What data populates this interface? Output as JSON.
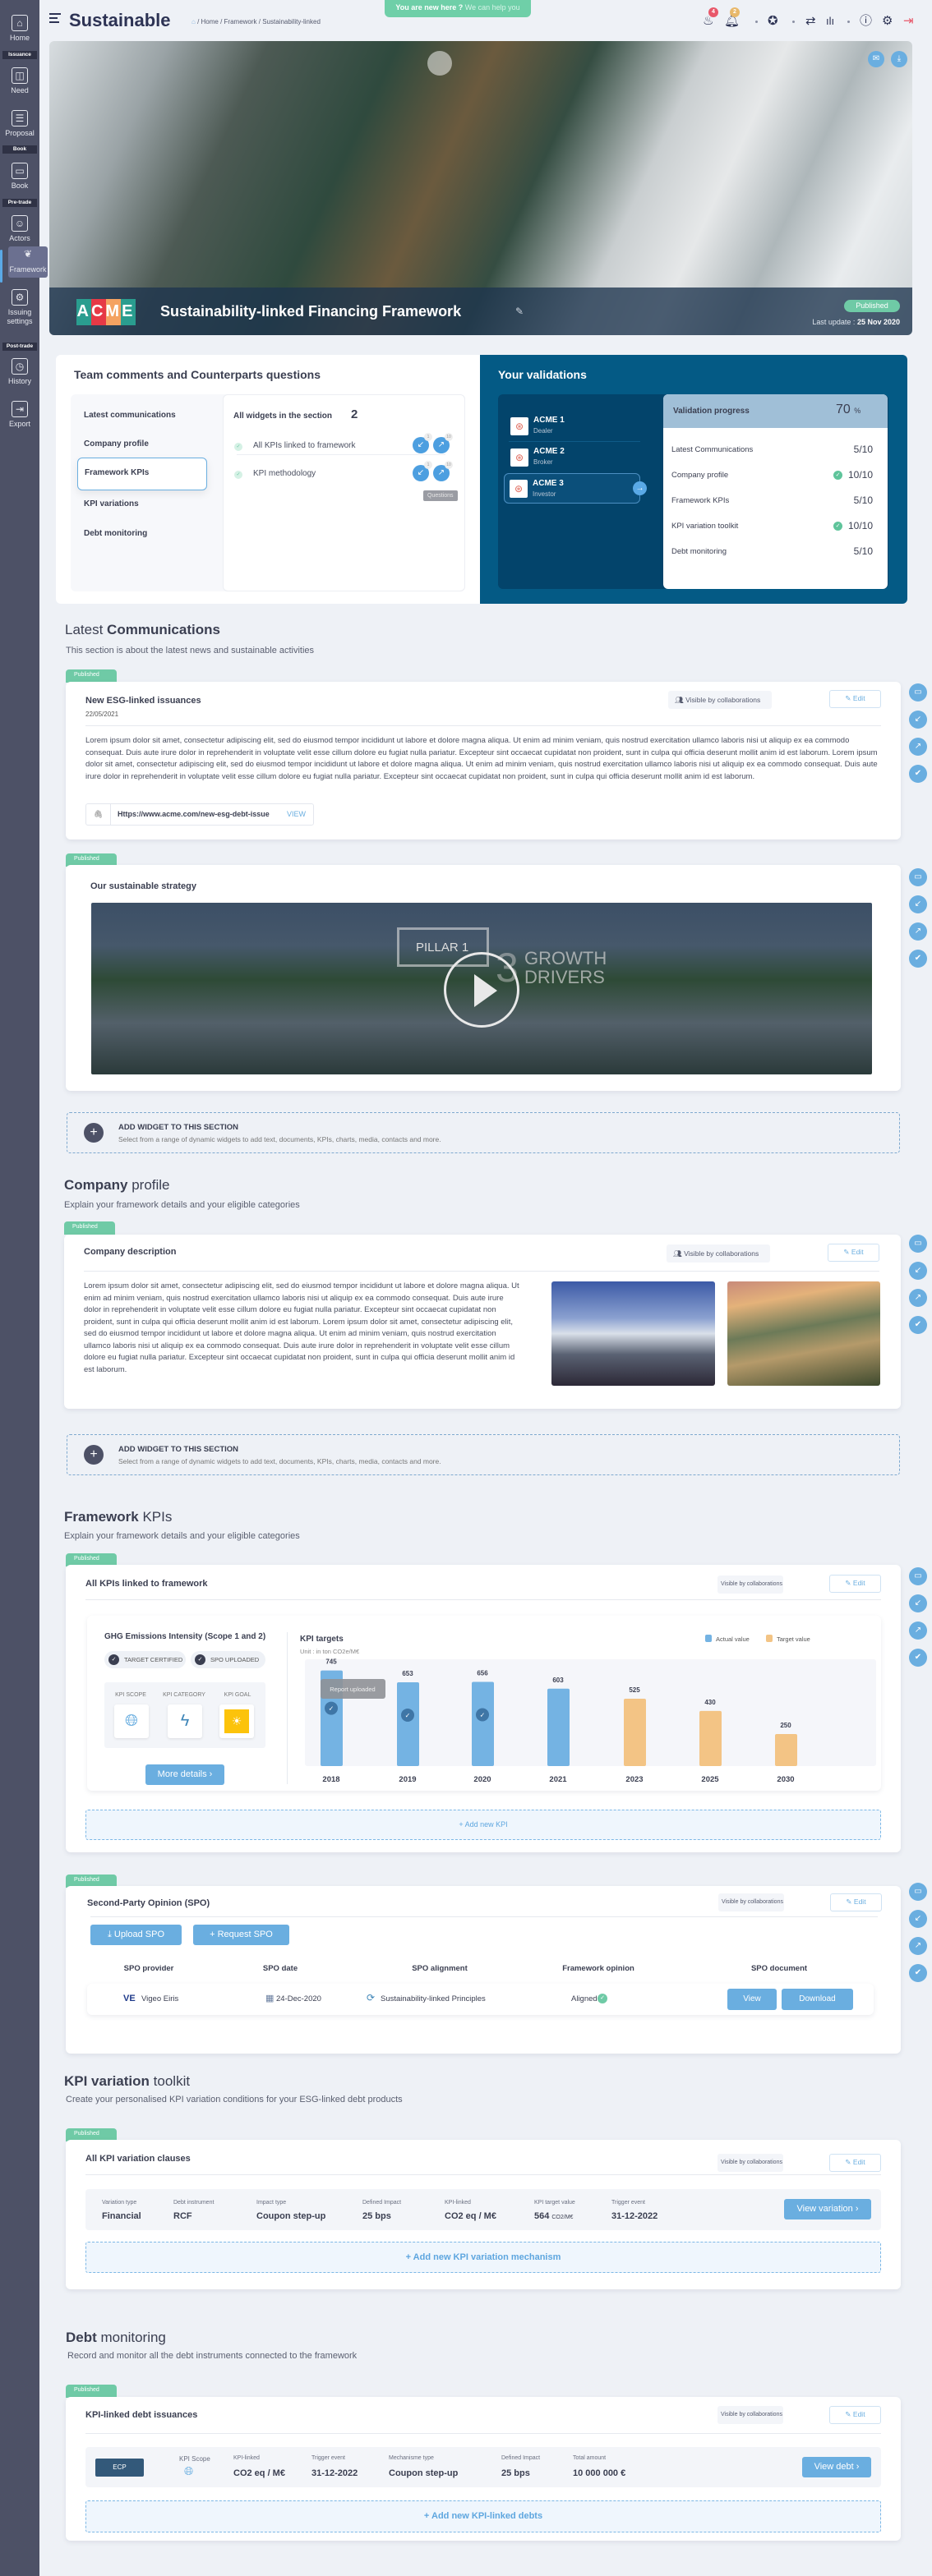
{
  "app": {
    "title": "Sustainable",
    "breadcrumb": "/ Home / Framework / Sustainability-linked",
    "help_strong": "You are new here ?",
    "help_link": "We can help you"
  },
  "header_icons": {
    "fire_badge": "4",
    "bell_badge": "2",
    "icons": [
      "fire-icon",
      "bell-icon",
      "award-icon",
      "transfer-icon",
      "bar-chart-icon",
      "help-icon",
      "gear-icon",
      "logout-icon"
    ]
  },
  "sidebar": {
    "items": [
      {
        "label": "Home",
        "icon": "home-icon"
      },
      {
        "tag": "Issuance"
      },
      {
        "label": "Need",
        "icon": "need-icon"
      },
      {
        "label": "Proposal",
        "icon": "proposal-icon"
      },
      {
        "tag": "Book"
      },
      {
        "label": "Book",
        "icon": "book-icon"
      },
      {
        "tag": "Pre-trade"
      },
      {
        "label": "Actors",
        "icon": "actors-icon"
      },
      {
        "label": "Framework",
        "icon": "framework-icon",
        "active": true
      },
      {
        "label": "Issuing settings",
        "icon": "settings-icon"
      },
      {
        "tag": "Post-trade"
      },
      {
        "label": "History",
        "icon": "history-icon"
      },
      {
        "label": "Export",
        "icon": "export-icon"
      }
    ]
  },
  "hero": {
    "logo": "ACME",
    "title": "Sustainability-linked Financing Framework",
    "status": "Published",
    "last_update_label": "Last update :",
    "last_update": "25 Nov 2020"
  },
  "comments": {
    "title": "Team comments and Counterparts questions",
    "nav": [
      "Latest communications",
      "Company profile",
      "Framework KPIs",
      "KPI variations",
      "Debt monitoring"
    ],
    "active_index": 2,
    "widgets_label": "All widgets in the section",
    "widgets_count": "2",
    "widgets": [
      {
        "name": "All KPIs linked to framework",
        "comments": "1",
        "questions": "10"
      },
      {
        "name": "KPI methodology",
        "comments": "1",
        "questions": "10"
      }
    ],
    "tooltip": "Questions"
  },
  "validations": {
    "title": "Your validations",
    "counterparts": [
      {
        "name": "ACME 1",
        "role": "Dealer"
      },
      {
        "name": "ACME 2",
        "role": "Broker"
      },
      {
        "name": "ACME 3",
        "role": "Investor",
        "active": true
      }
    ],
    "progress_label": "Validation progress",
    "progress_value": "70",
    "progress_unit": "%",
    "rows": [
      {
        "label": "Latest Communications",
        "value": "5/10",
        "done": false
      },
      {
        "label": "Company profile",
        "value": "10/10",
        "done": true
      },
      {
        "label": "Framework KPIs",
        "value": "5/10",
        "done": false
      },
      {
        "label": "KPI variation toolkit",
        "value": "10/10",
        "done": true
      },
      {
        "label": "Debt monitoring",
        "value": "5/10",
        "done": false
      }
    ]
  },
  "common": {
    "published": "Published",
    "visible": "Visible by collaborations",
    "edit": "Edit",
    "add_widget_title": "ADD WIDGET TO THIS SECTION",
    "add_widget_sub": "Select from a range of dynamic widgets to add text, documents, KPIs, charts, media, contacts and more."
  },
  "latest": {
    "title_light": "Latest",
    "title_bold": "Communications",
    "subtitle": "This section is about the latest news and sustainable activities",
    "card1": {
      "title": "New ESG-linked issuances",
      "date": "22/05/2021",
      "body": "Lorem ipsum dolor sit amet, consectetur adipiscing elit, sed do eiusmod tempor incididunt ut labore et dolore magna aliqua. Ut enim ad minim veniam, quis nostrud exercitation ullamco laboris nisi ut aliquip ex ea commodo consequat. Duis aute irure dolor in reprehenderit in voluptate velit esse cillum dolore eu fugiat nulla pariatur. Excepteur sint occaecat cupidatat non proident, sunt in culpa qui officia deserunt mollit anim id est laborum. Lorem ipsum dolor sit amet, consectetur adipiscing elit, sed do eiusmod tempor incididunt ut labore et dolore magna aliqua. Ut enim ad minim veniam, quis nostrud exercitation ullamco laboris nisi ut aliquip ex ea commodo consequat. Duis aute irure dolor in reprehenderit in voluptate velit esse cillum dolore eu fugiat nulla pariatur. Excepteur sint occaecat cupidatat non proident, sunt in culpa qui officia deserunt mollit anim id est laborum.",
      "link": "Https://www.acme.com/new-esg-debt-issue",
      "link_action": "VIEW"
    },
    "card2": {
      "title": "Our sustainable strategy",
      "video_text_1": "PILLAR 1",
      "video_text_2": "3",
      "video_text_3": "GROWTH",
      "video_text_4": "DRIVERS"
    }
  },
  "company": {
    "title_bold": "Company",
    "title_light": "profile",
    "subtitle": "Explain your framework details and your eligible categories",
    "card_title": "Company description",
    "body": "Lorem ipsum dolor sit amet, consectetur adipiscing elit, sed do eiusmod tempor incididunt ut labore et dolore magna aliqua. Ut enim ad minim veniam, quis nostrud exercitation ullamco laboris nisi ut aliquip ex ea commodo consequat. Duis aute irure dolor in reprehenderit in voluptate velit esse cillum dolore eu fugiat nulla pariatur. Excepteur sint occaecat cupidatat non proident, sunt in culpa qui officia deserunt mollit anim id est laborum. Lorem ipsum dolor sit amet, consectetur adipiscing elit, sed do eiusmod tempor incididunt ut labore et dolore magna aliqua. Ut enim ad minim veniam, quis nostrud exercitation ullamco laboris nisi ut aliquip ex ea commodo consequat. Duis aute irure dolor in reprehenderit in voluptate velit esse cillum dolore eu fugiat nulla pariatur. Excepteur sint occaecat cupidatat non proident, sunt in culpa qui officia deserunt mollit anim id est laborum."
  },
  "kpis": {
    "title_bold": "Framework",
    "title_light": "KPIs",
    "subtitle": "Explain your framework details and your eligible categories",
    "card_title": "All KPIs linked to framework",
    "kpi_name": "GHG Emissions Intensity (Scope 1 and 2)",
    "badges": [
      "TARGET CERTIFIED",
      "SPO UPLOADED"
    ],
    "meta": [
      "KPI SCOPE",
      "KPI CATEGORY",
      "KPI GOAL"
    ],
    "more": "More details",
    "add_new": "Add new KPI",
    "bar_tooltip": "Report uploaded"
  },
  "chart_data": {
    "type": "bar",
    "title": "KPI targets",
    "subtitle": "Unit : in ton CO2e/M€",
    "categories": [
      "2018",
      "2019",
      "2020",
      "2021",
      "2023",
      "2025",
      "2030"
    ],
    "series": [
      {
        "name": "Actual value",
        "values": [
          745,
          653,
          656,
          603,
          null,
          null,
          null
        ],
        "color": "#74b3e3"
      },
      {
        "name": "Target value",
        "values": [
          null,
          null,
          null,
          null,
          525,
          430,
          250
        ],
        "color": "#f3c485"
      }
    ],
    "report_uploaded": [
      true,
      true,
      true,
      false,
      false,
      false,
      false
    ],
    "legend": "top-right",
    "grid": false
  },
  "spo": {
    "title": "Second-Party Opinion (SPO)",
    "upload": "Upload SPO",
    "request": "Request SPO",
    "columns": [
      "SPO provider",
      "SPO date",
      "SPO alignment",
      "Framework opinion",
      "SPO document"
    ],
    "row": {
      "provider_logo": "VE",
      "provider": "Vigeo Eiris",
      "date": "24-Dec-2020",
      "alignment": "Sustainability-linked Principles",
      "opinion": "Aligned",
      "view": "View",
      "download": "Download"
    }
  },
  "variation": {
    "title_bold": "KPI variation",
    "title_light": "toolkit",
    "subtitle": "Create your personalised KPI variation conditions for your ESG-linked debt products",
    "card_title": "All KPI variation clauses",
    "fields": [
      {
        "label": "Variation type",
        "value": "Financial"
      },
      {
        "label": "Debt instrument",
        "value": "RCF"
      },
      {
        "label": "Impact type",
        "value": "Coupon step-up"
      },
      {
        "label": "Defined Impact",
        "value": "25 bps"
      },
      {
        "label": "KPI-linked",
        "value": "CO2 eq / M€"
      },
      {
        "label": "KPI target value",
        "value": "564",
        "unit": "CO2/M€"
      },
      {
        "label": "Trigger event",
        "value": "31-12-2022"
      }
    ],
    "view": "View variation",
    "add_new": "Add new KPI variation mechanism"
  },
  "debt": {
    "title_bold": "Debt",
    "title_light": "monitoring",
    "subtitle": "Record and monitor all the debt instruments connected to the framework",
    "card_title": "KPI-linked debt issuances",
    "instrument": "ECP",
    "scope_label": "KPI Scope",
    "fields": [
      {
        "label": "KPI-linked",
        "value": "CO2 eq / M€"
      },
      {
        "label": "Trigger event",
        "value": "31-12-2022"
      },
      {
        "label": "Mechanisme type",
        "value": "Coupon step-up"
      },
      {
        "label": "Defined Impact",
        "value": "25 bps"
      },
      {
        "label": "Total amount",
        "value": "10 000 000 €"
      }
    ],
    "view": "View debt",
    "add_new": "Add new KPI-linked debts"
  },
  "float_icons": [
    "widget-icon",
    "comment-in-icon",
    "question-out-icon",
    "user-check-icon"
  ],
  "colors": {
    "accent": "#6aaee0",
    "published": "#6fcaa6",
    "sidebar": "#4d5166",
    "validation_panel": "#045a85"
  }
}
